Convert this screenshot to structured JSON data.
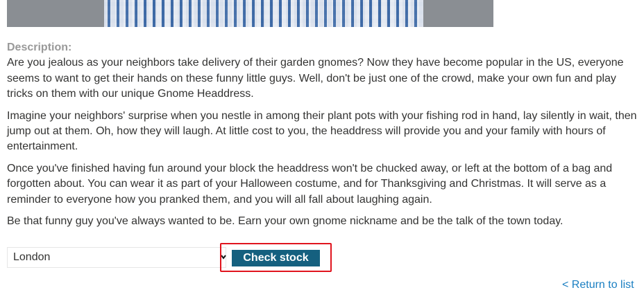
{
  "product": {
    "image_alt": "product-photo-checkered-shirt"
  },
  "description": {
    "label": "Description:",
    "paragraphs": [
      "Are you jealous as your neighbors take delivery of their garden gnomes? Now they have become popular in the US, everyone seems to want to get their hands on these funny little guys. Well, don't be just one of the crowd, make your own fun and play tricks on them with our unique Gnome Headdress.",
      "Imagine your neighbors' surprise when you nestle in among their plant pots with your fishing rod in hand, lay silently in wait, then jump out at them. Oh, how they will laugh. At little cost to you, the headdress will provide you and your family with hours of entertainment.",
      "Once you've finished having fun around your block the headdress won't be chucked away, or left at the bottom of a bag and forgotten about. You can wear it as part of your Halloween costume, and for Thanksgiving and Christmas. It will serve as a reminder to everyone how you pranked them, and you will all fall about laughing again.",
      "Be that funny guy you've always wanted to be. Earn your own gnome nickname and be the talk of the town today."
    ]
  },
  "stock_check": {
    "store_selected": "London",
    "button_label": "Check stock",
    "highlight_color": "#e0141e",
    "button_color": "#15607f"
  },
  "navigation": {
    "return_link": "< Return to list",
    "link_color": "#1a7fc2"
  }
}
